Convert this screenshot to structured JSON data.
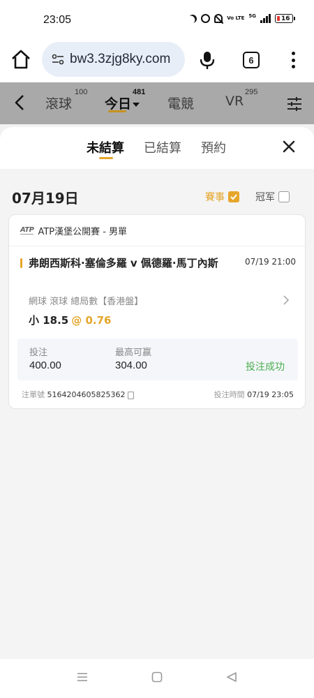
{
  "status_bar": {
    "time": "23:05",
    "battery_level": "16",
    "network": "5G",
    "volte": "Vo LTE",
    "icons": [
      "moon-icon",
      "alarm-icon",
      "mute-icon",
      "volte-icon",
      "signal-icon",
      "battery-icon"
    ]
  },
  "browser": {
    "url": "bw3.3zjg8ky.com",
    "tab_count": "6",
    "icons": [
      "home-icon",
      "site-settings-icon",
      "mic-icon",
      "tabs-icon",
      "more-vert-icon"
    ]
  },
  "app_header": {
    "tabs": [
      {
        "label": "滾球",
        "count": "100"
      },
      {
        "label": "今日",
        "count": "481",
        "active": true
      },
      {
        "label": "電競",
        "count": ""
      },
      {
        "label": "VR",
        "count": "295"
      }
    ]
  },
  "sheet": {
    "tabs": [
      {
        "label": "未結算",
        "active": true
      },
      {
        "label": "已結算"
      },
      {
        "label": "預約"
      }
    ],
    "date": "07月19日",
    "filters": [
      {
        "label": "賽事",
        "checked": true
      },
      {
        "label": "冠军",
        "checked": false
      }
    ]
  },
  "bet": {
    "league": "ATP漢堡公開賽 - 男單",
    "logo_text": "ATP",
    "match": "弗朗西斯科·塞倫多羅 v 佩德羅·馬丁內斯",
    "match_time": "07/19 21:00",
    "market": "網球  滾球   總局數【香港盤】",
    "selection": "小 18.5",
    "odds": "@ 0.76",
    "stake_label": "投注",
    "stake_value": "400.00",
    "max_win_label": "最高可赢",
    "max_win_value": "304.00",
    "status": "投注成功",
    "ticket_label": "注單號",
    "ticket_no": "5164204605825362",
    "bet_time_label": "投注時間",
    "bet_time": "07/19 23:05"
  },
  "colors": {
    "accent": "#e5a62a",
    "success": "#4caf50",
    "dim_header": "#a9a9a9"
  }
}
